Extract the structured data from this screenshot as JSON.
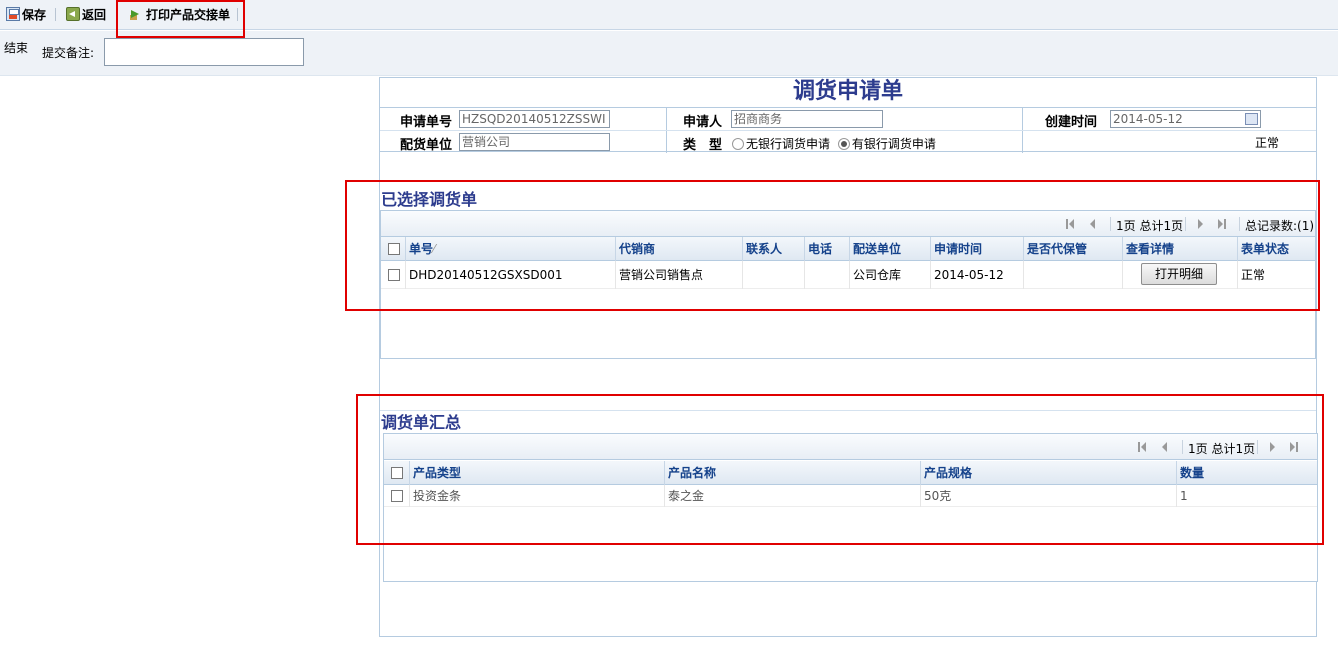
{
  "toolbar": {
    "save_label": "保存",
    "back_label": "返回",
    "print_label": "打印产品交接单"
  },
  "submit": {
    "end_label": "结束",
    "remark_label": "提交备注:",
    "remark_value": ""
  },
  "form": {
    "title": "调货申请单",
    "apply_no_label": "申请单号",
    "apply_no_value": "HZSQD20140512ZSSWI",
    "applicant_label": "申请人",
    "applicant_value": "招商商务",
    "created_label": "创建时间",
    "created_value": "2014-05-12",
    "dist_unit_label": "配货单位",
    "dist_unit_value": "营销公司",
    "type_label": "类　型",
    "type_option1": "无银行调货申请",
    "type_option2": "有银行调货申请",
    "type_selected": "有银行调货申请",
    "status": "正常"
  },
  "selected_orders": {
    "title": "已选择调货单",
    "pager": {
      "page_info": "1页 总计1页",
      "total": "总记录数:(1)"
    },
    "columns": [
      "单号",
      "代销商",
      "联系人",
      "电话",
      "配送单位",
      "申请时间",
      "是否代保管",
      "查看详情",
      "表单状态"
    ],
    "sort_mark": "⁄",
    "rows": [
      {
        "order_no": "DHD20140512GSXSD001",
        "agent": "营销公司销售点",
        "contact": "",
        "phone": "",
        "delivery_unit": "公司仓库",
        "apply_time": "2014-05-12",
        "custody": "",
        "detail_button": "打开明细",
        "status": "正常"
      }
    ]
  },
  "summary": {
    "title": "调货单汇总",
    "pager": {
      "page_info": "1页 总计1页"
    },
    "columns": [
      "产品类型",
      "产品名称",
      "产品规格",
      "数量"
    ],
    "rows": [
      {
        "type": "投资金条",
        "name": "泰之金",
        "spec": "50克",
        "qty": "1"
      }
    ]
  }
}
